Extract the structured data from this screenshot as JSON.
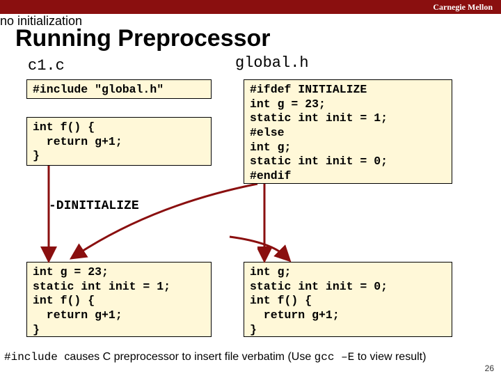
{
  "header": {
    "org": "Carnegie Mellon"
  },
  "title": "Running Preprocessor",
  "files": {
    "left": "c1.c",
    "right": "global.h"
  },
  "code": {
    "include": "#include \"global.h\"",
    "func": "int f() {\n  return g+1;\n}",
    "header": "#ifdef INITIALIZE\nint g = 23;\nstatic int init = 1;\n#else\nint g;\nstatic int init = 0;\n#endif",
    "out_init": "int g = 23;\nstatic int init = 1;\nint f() {\n  return g+1;\n}",
    "out_noinit": "int g;\nstatic int init = 0;\nint f() {\n  return g+1;\n}"
  },
  "labels": {
    "dinit": "-DINITIALIZE",
    "noinit": "no initialization"
  },
  "footer": {
    "pre1": "#include ",
    "mid1": " causes C preprocessor to insert file verbatim (Use ",
    "pre2": "gcc –E",
    "mid2": " to view result)"
  },
  "page": "26"
}
